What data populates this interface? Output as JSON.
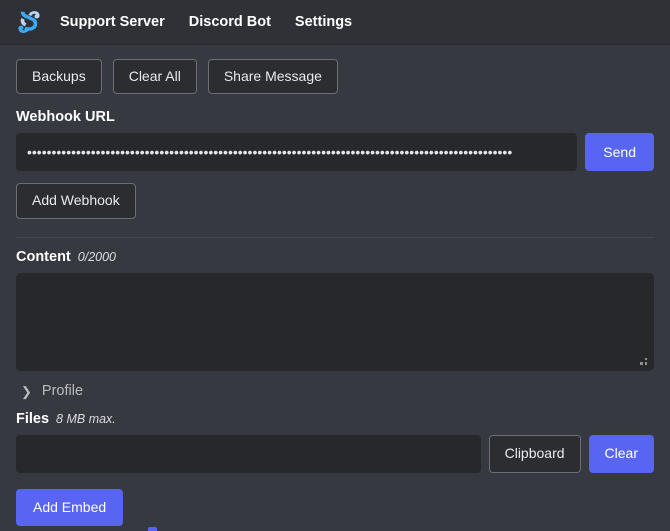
{
  "app": {
    "logo_icon": "embed-generator-s-logo-icon",
    "brand_colors": {
      "logo_light": "#b9d7f5",
      "logo_blue": "#3ba9f4",
      "blurple": "#5865f2"
    },
    "background": "#36393f",
    "navbar_background": "#2f3136"
  },
  "navbar": {
    "links": [
      {
        "label": "Support Server",
        "name": "nav-link-support-server"
      },
      {
        "label": "Discord Bot",
        "name": "nav-link-discord-bot"
      },
      {
        "label": "Settings",
        "name": "nav-link-settings"
      }
    ]
  },
  "toolbar": {
    "backups_label": "Backups",
    "clear_all_label": "Clear All",
    "share_message_label": "Share Message"
  },
  "webhook": {
    "label": "Webhook URL",
    "value": "•••••••••••••••••••••••••••••••••••••••••••••••••••••••••••••••••••••••••••••••••••••••••••••••••••",
    "placeholder": "",
    "send_label": "Send",
    "add_webhook_label": "Add Webhook"
  },
  "content": {
    "label": "Content",
    "counter": "0/2000",
    "value": "",
    "placeholder": "",
    "resize_grip_icon": "resize-grip-icon"
  },
  "profile": {
    "label": "Profile",
    "chevron_icon": "chevron-right-icon",
    "expanded": false
  },
  "files": {
    "label": "Files",
    "hint": "8 MB max.",
    "value": "",
    "clipboard_label": "Clipboard",
    "clear_label": "Clear"
  },
  "embeds": {
    "add_embed_label": "Add Embed"
  }
}
